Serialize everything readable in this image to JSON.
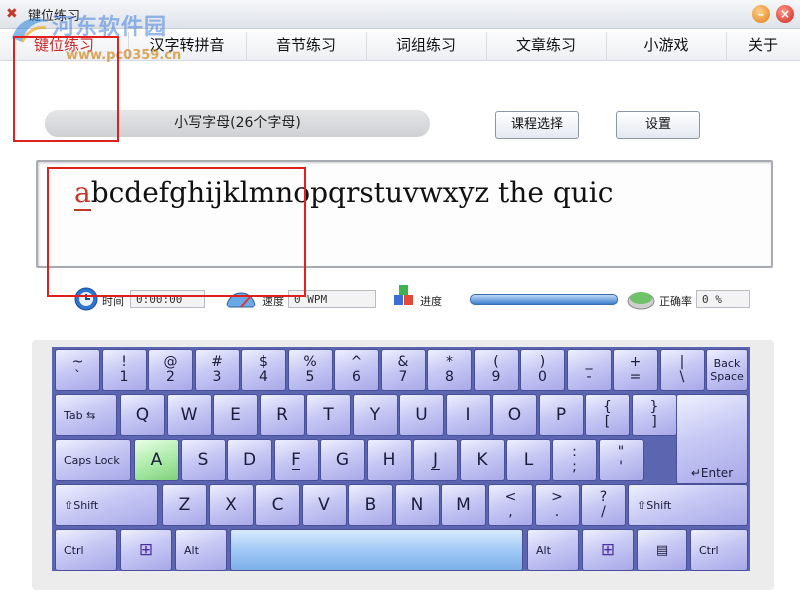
{
  "window": {
    "title": "键位练习",
    "min_label": "–",
    "close_label": "×"
  },
  "watermark": {
    "title": "河东软件园",
    "url": "www.pc0359.cn"
  },
  "tabs": [
    "键位练习",
    "汉字转拼音",
    "音节练习",
    "词组练习",
    "文章练习",
    "小游戏",
    "关于"
  ],
  "lesson": {
    "current": "小写字母(26个字母)",
    "choose_label": "课程选择",
    "settings_label": "设置"
  },
  "typing": {
    "current_char": "a",
    "remaining": "bcdefghijklmnopqrstuvwxyz the quic"
  },
  "status": {
    "time_label": "时间",
    "time_value": "0:00:00",
    "speed_label": "速度",
    "speed_value": "0 WPM",
    "progress_label": "进度",
    "progress_fraction": 1.0,
    "accuracy_label": "正确率",
    "accuracy_value": "0 %"
  },
  "keyboard": {
    "row1": [
      {
        "top": "~",
        "bot": "`"
      },
      {
        "top": "!",
        "bot": "1"
      },
      {
        "top": "@",
        "bot": "2"
      },
      {
        "top": "#",
        "bot": "3"
      },
      {
        "top": "$",
        "bot": "4"
      },
      {
        "top": "%",
        "bot": "5"
      },
      {
        "top": "^",
        "bot": "6"
      },
      {
        "top": "&",
        "bot": "7"
      },
      {
        "top": "*",
        "bot": "8"
      },
      {
        "top": "(",
        "bot": "9"
      },
      {
        "top": ")",
        "bot": "0"
      },
      {
        "top": "_",
        "bot": "-"
      },
      {
        "top": "+",
        "bot": "="
      },
      {
        "top": "|",
        "bot": "\\"
      }
    ],
    "backspace": "Back Space",
    "tab": "Tab ⇆",
    "row2": [
      "Q",
      "W",
      "E",
      "R",
      "T",
      "Y",
      "U",
      "I",
      "O",
      "P"
    ],
    "row2_sym": [
      {
        "top": "{",
        "bot": "["
      },
      {
        "top": "}",
        "bot": "]"
      }
    ],
    "caps": "Caps Lock",
    "row3": [
      "A",
      "S",
      "D",
      "F",
      "G",
      "H",
      "J",
      "K",
      "L"
    ],
    "row3_sym": [
      {
        "top": ":",
        "bot": ";"
      },
      {
        "top": "\"",
        "bot": "'"
      }
    ],
    "enter": "↵Enter",
    "shift": "⇧Shift",
    "row4": [
      "Z",
      "X",
      "C",
      "V",
      "B",
      "N",
      "M"
    ],
    "row4_sym": [
      {
        "top": "<",
        "bot": ","
      },
      {
        "top": ">",
        "bot": "."
      },
      {
        "top": "?",
        "bot": "/"
      }
    ],
    "ctrl": "Ctrl",
    "alt": "Alt",
    "win_icon": "⊞",
    "menu_icon": "▤",
    "highlight_key": "A",
    "home_keys": [
      "F",
      "J"
    ]
  },
  "colors": {
    "key_active": "#8fdc8c",
    "annotation": "#e0201c",
    "active_tab": "#cc2a2a"
  }
}
